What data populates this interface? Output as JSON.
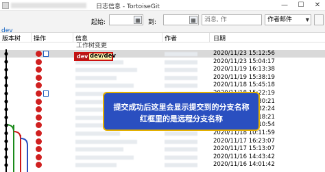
{
  "window": {
    "title": "日志信息 - TortoiseGit",
    "minimize_glyph": "—",
    "maximize_glyph": "☐",
    "close_glyph": "✕"
  },
  "toolbar": {
    "branch": "dev",
    "from_label": "起始:",
    "to_label": "到:",
    "search_placeholder": "消息, 作",
    "filter_value": "作者邮件",
    "filter_arrow": "▼"
  },
  "columns": {
    "graph": "版本树",
    "actions": "操作",
    "message": "信息",
    "author": "作者",
    "date": "日期"
  },
  "working_copy_label": "工作树变更",
  "refs": {
    "local": "dev",
    "remote": "dev/dev"
  },
  "dates": [
    "2020/11/23 15:12:56",
    "2020/11/23 15:04:17",
    "2020/11/19 16:13:38",
    "2020/11/19 15:38:19",
    "2020/11/18 15:45:18",
    "2020/11/18 15:22:19",
    "2020/11/18 15:30:21",
    "2020/11/18 10:32:24",
    "2020/11/18 10:18:21",
    "2020/11/18 10:10:54",
    "2020/11/18 10:11:59",
    "2020/11/17 16:23:07",
    "2020/11/17 15:13:07",
    "2020/11/16 14:43:42",
    "2020/11/16 14:01:42"
  ],
  "callout": {
    "line1": "提交成功后这里会显示提交到的分支名称",
    "line2": "红框里的是远程分支名称"
  },
  "colors": {
    "callout_bg": "#2a4fc0",
    "callout_border": "#e4b000",
    "badge_local": "#b31818",
    "badge_highlight": "#fff7b0",
    "branch_text": "#1060c0"
  }
}
